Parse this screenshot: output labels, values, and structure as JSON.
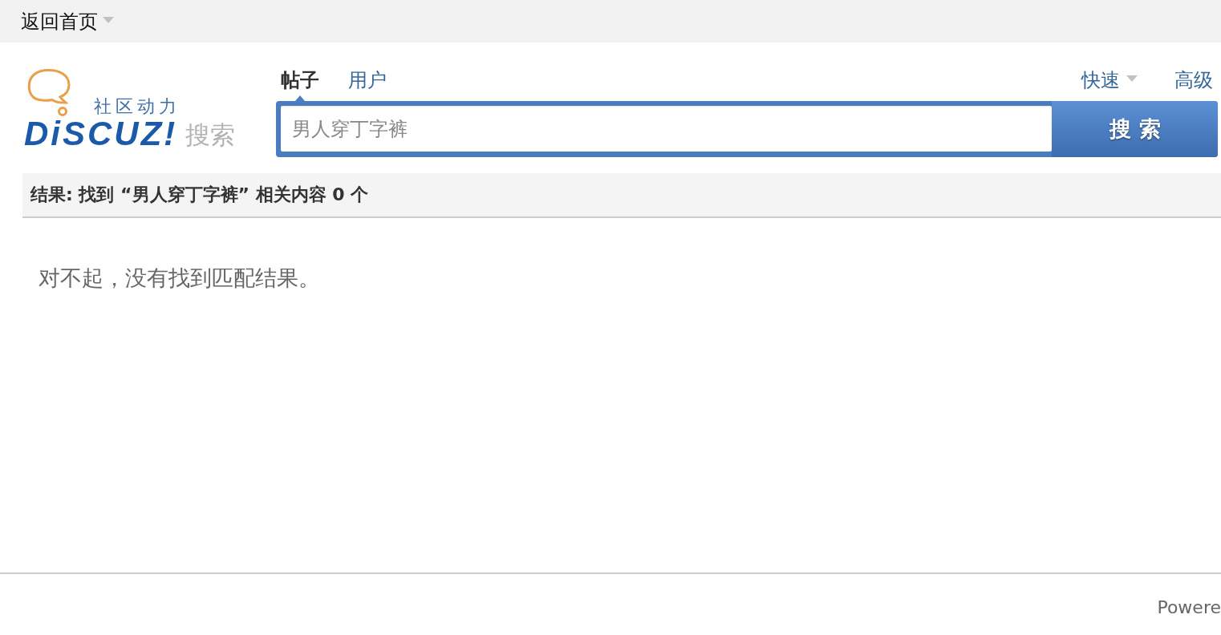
{
  "top_bar": {
    "home_link": {
      "label": "返回首页",
      "dropdown": true
    }
  },
  "logo": {
    "tagline": "社区动力",
    "name": "DiSCUZ!",
    "suffix": "搜索"
  },
  "search": {
    "tabs": [
      {
        "label": "帖子",
        "selected": true
      },
      {
        "label": "用户",
        "selected": false
      }
    ],
    "mode_links": [
      {
        "label": "快速",
        "dropdown": true
      },
      {
        "label": "高级",
        "dropdown": false
      }
    ],
    "query": {
      "value": "男人穿丁字裤"
    },
    "submit_button": "搜索"
  },
  "results": {
    "summary": "结果: 找到 “男人穿丁字裤” 相关内容 0 个",
    "message": "对不起，没有找到匹配结果。"
  },
  "footer": {
    "powered_by": "Powere"
  }
}
